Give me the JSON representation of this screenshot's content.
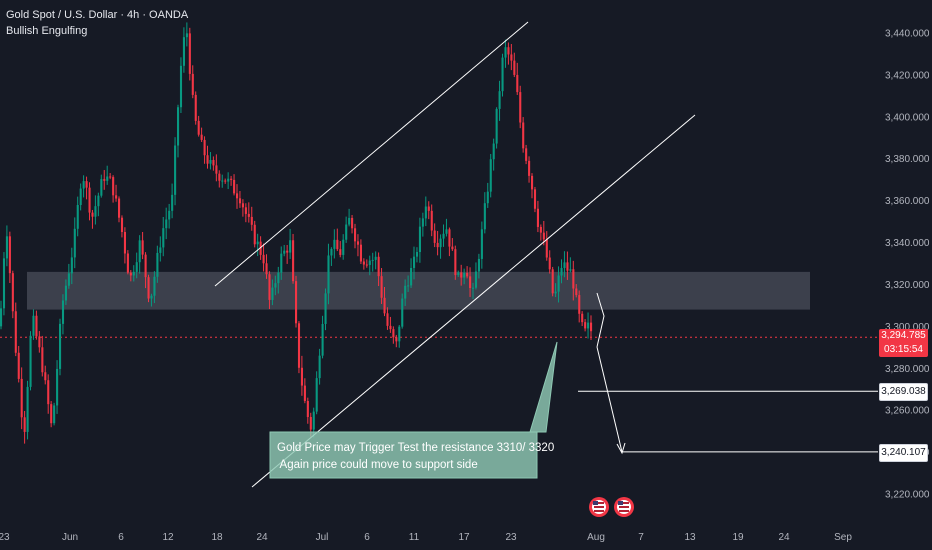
{
  "header": {
    "symbol_line": "Gold Spot / U.S. Dollar · 4h · OANDA",
    "indicator": "Bullish Engulfing"
  },
  "price_tags": {
    "last_price": "3,294.785",
    "countdown": "03:15:54",
    "level_1": "3,269.038",
    "level_2": "3,240.107"
  },
  "annotation": {
    "line1": "Gold Price may Trigger Test the resistance 3310/ 3320",
    "line2": " Again price could move to support side"
  },
  "colors": {
    "background": "#161a25",
    "up": "#089981",
    "down": "#f23645",
    "callout": "#8fc9b4",
    "zone": "#4a4e59"
  },
  "event_icons": [
    "us-flag-icon",
    "us-flag-icon"
  ],
  "chart_data": {
    "type": "candlestick",
    "xticks": [
      "23",
      "Jun",
      "6",
      "12",
      "18",
      "24",
      "Jul",
      "6",
      "11",
      "17",
      "23",
      "Aug",
      "7",
      "13",
      "19",
      "24",
      "Sep"
    ],
    "yticks": [
      "3,220.000",
      "3,240.000",
      "3,260.000",
      "3,280.000",
      "3,300.000",
      "3,320.000",
      "3,340.000",
      "3,360.000",
      "3,380.000",
      "3,400.000",
      "3,420.000",
      "3,440.000"
    ],
    "ylim": [
      3206,
      3452
    ],
    "last_price": 3294.785,
    "resistance_zone": [
      3308,
      3326
    ],
    "support_levels": [
      3269.038,
      3240.107
    ],
    "anchors": [
      [
        0,
        3300
      ],
      [
        6,
        3352
      ],
      [
        14,
        3298
      ],
      [
        24,
        3248
      ],
      [
        32,
        3305
      ],
      [
        42,
        3282
      ],
      [
        52,
        3250
      ],
      [
        62,
        3310
      ],
      [
        74,
        3340
      ],
      [
        82,
        3375
      ],
      [
        92,
        3352
      ],
      [
        104,
        3372
      ],
      [
        112,
        3368
      ],
      [
        122,
        3345
      ],
      [
        130,
        3322
      ],
      [
        140,
        3340
      ],
      [
        150,
        3312
      ],
      [
        162,
        3345
      ],
      [
        172,
        3360
      ],
      [
        180,
        3420
      ],
      [
        186,
        3445
      ],
      [
        194,
        3400
      ],
      [
        202,
        3385
      ],
      [
        212,
        3375
      ],
      [
        226,
        3370
      ],
      [
        240,
        3362
      ],
      [
        252,
        3345
      ],
      [
        264,
        3332
      ],
      [
        270,
        3310
      ],
      [
        280,
        3332
      ],
      [
        290,
        3340
      ],
      [
        298,
        3285
      ],
      [
        306,
        3260
      ],
      [
        312,
        3250
      ],
      [
        322,
        3302
      ],
      [
        330,
        3340
      ],
      [
        340,
        3335
      ],
      [
        350,
        3352
      ],
      [
        362,
        3332
      ],
      [
        376,
        3332
      ],
      [
        386,
        3302
      ],
      [
        396,
        3290
      ],
      [
        404,
        3318
      ],
      [
        414,
        3330
      ],
      [
        426,
        3360
      ],
      [
        436,
        3340
      ],
      [
        446,
        3348
      ],
      [
        458,
        3322
      ],
      [
        466,
        3330
      ],
      [
        472,
        3312
      ],
      [
        482,
        3345
      ],
      [
        490,
        3375
      ],
      [
        496,
        3398
      ],
      [
        504,
        3433
      ],
      [
        510,
        3428
      ],
      [
        516,
        3415
      ],
      [
        522,
        3390
      ],
      [
        530,
        3372
      ],
      [
        538,
        3350
      ],
      [
        546,
        3335
      ],
      [
        554,
        3312
      ],
      [
        562,
        3330
      ],
      [
        572,
        3325
      ],
      [
        578,
        3306
      ],
      [
        584,
        3296
      ],
      [
        590,
        3301
      ],
      [
        592,
        3294.785
      ]
    ]
  }
}
